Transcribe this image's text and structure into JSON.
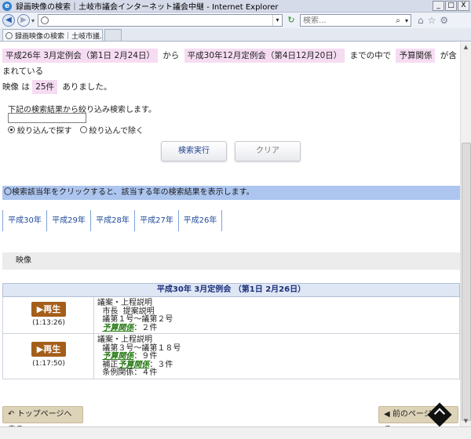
{
  "window": {
    "title": "録画映像の検索｜土岐市議会インターネット議会中継 - Internet Explorer",
    "minimize": "_",
    "maximize": "□",
    "close": "X"
  },
  "addressbar": {
    "url": "",
    "search_placeholder": "検索..."
  },
  "tab": {
    "label": "録画映像の検索｜土岐市議...",
    "close": "×"
  },
  "condition": {
    "from_meeting": "平成26年 3月定例会（第1日 2月24日）",
    "from_word": "から",
    "to_meeting": "平成30年12月定例会（第4日12月20日）",
    "to_word": "までの中で",
    "keyword": "予算関係",
    "contains_word": "が含まれている",
    "video_word": "映像 は",
    "count": "25件",
    "result_word": "ありました。"
  },
  "refine": {
    "label": "下記の検索結果から絞り込み検索します。",
    "input_value": "",
    "options": [
      "絞り込んで探す",
      "絞り込んで除く"
    ],
    "selected_index": 0
  },
  "buttons": {
    "search": "検索実行",
    "clear": "クリア"
  },
  "info_text": "〇検索該当年をクリックすると、該当する年の検索結果を表示します。",
  "years": [
    "平成30年",
    "平成29年",
    "平成28年",
    "平成27年",
    "平成26年"
  ],
  "section_title": "映像",
  "session_title": "平成30年 3月定例会 （第1日 2月26日）",
  "videos": [
    {
      "play_label": "再生",
      "duration": "(1:13:26)",
      "lines": [
        {
          "text": "議案・上程説明",
          "budget": false
        },
        {
          "text": "  市長  提案説明",
          "budget": false
        },
        {
          "text": "  議第１号～議第２号",
          "budget": false
        },
        {
          "text": "  予算関係",
          "budget": true,
          "suffix": "：２件"
        }
      ]
    },
    {
      "play_label": "再生",
      "duration": "(1:17:50)",
      "lines": [
        {
          "text": "議案・上程説明",
          "budget": false
        },
        {
          "text": "  議第３号～議第１８号",
          "budget": false
        },
        {
          "text": "  予算関係",
          "budget": true,
          "suffix": "：９件"
        },
        {
          "text": "  補正予算関係",
          "budget": true,
          "prefix": "  補正",
          "suffix": "：３件"
        },
        {
          "text": "  条例関係：４件",
          "budget": false
        }
      ]
    }
  ],
  "footer": {
    "top_page": "トップページへ戻る",
    "prev_page": "前のページへ戻る"
  },
  "icons": {
    "back": "back-icon",
    "forward": "forward-icon",
    "refresh": "refresh-icon",
    "search": "search-icon",
    "home": "home-icon",
    "favorites": "star-icon",
    "settings": "gear-icon",
    "play": "play-icon",
    "page_top": "page-top-icon"
  }
}
